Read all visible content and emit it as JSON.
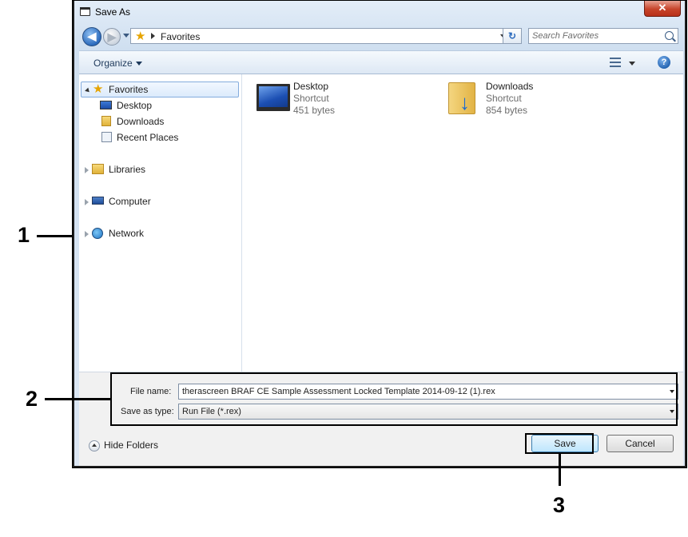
{
  "window": {
    "title": "Save As",
    "close_glyph": "✕"
  },
  "address_bar": {
    "breadcrumb": "Favorites",
    "search_placeholder": "Search Favorites",
    "back_glyph": "◀",
    "refresh_glyph": "↻"
  },
  "toolbar": {
    "organize_label": "Organize"
  },
  "nav_pane": {
    "items": [
      {
        "label": "Favorites",
        "icon": "star-icon",
        "selected": true
      },
      {
        "label": "Desktop",
        "icon": "desktop-icon"
      },
      {
        "label": "Downloads",
        "icon": "downloads-folder-icon"
      },
      {
        "label": "Recent Places",
        "icon": "recent-places-icon"
      },
      {
        "label": "Libraries",
        "icon": "libraries-icon"
      },
      {
        "label": "Computer",
        "icon": "computer-icon"
      },
      {
        "label": "Network",
        "icon": "network-icon"
      }
    ]
  },
  "files": [
    {
      "name": "Desktop",
      "type": "Shortcut",
      "size": "451 bytes",
      "icon": "desktop-icon"
    },
    {
      "name": "Downloads",
      "type": "Shortcut",
      "size": "854 bytes",
      "icon": "downloads-folder-icon"
    }
  ],
  "fields": {
    "file_name_label": "File name:",
    "file_name_value": "therascreen BRAF CE Sample Assessment Locked Template 2014-09-12 (1).rex",
    "save_type_label": "Save as type:",
    "save_type_value": "Run File (*.rex)"
  },
  "footer": {
    "hide_folders_label": "Hide Folders",
    "save_label": "Save",
    "cancel_label": "Cancel"
  },
  "callouts": {
    "one": "1",
    "two": "2",
    "three": "3"
  },
  "colors": {
    "frame": "#1c1c1c",
    "chrome": "#dce7f4",
    "selection": "#dcebfc",
    "save_button": "#bee6fd"
  }
}
